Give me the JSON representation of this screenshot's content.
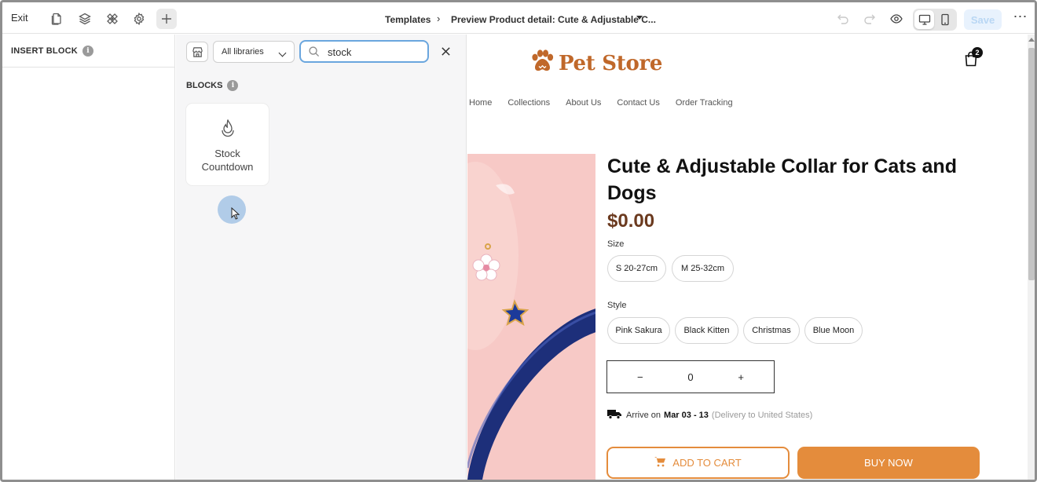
{
  "toolbar": {
    "exit_label": "Exit",
    "icons": [
      "pages-icon",
      "layers-icon",
      "theme-style-icon",
      "settings-icon",
      "add-icon"
    ],
    "breadcrumb_root": "Templates",
    "breadcrumb_current": "Preview Product detail: Cute & Adjustable C...",
    "save_label": "Save",
    "more_label": "⋯"
  },
  "left_panel": {
    "title": "INSERT BLOCK",
    "info_glyph": "i"
  },
  "library": {
    "library_select_value": "All libraries",
    "search_value": "stock",
    "blocks_heading": "BLOCKS",
    "blocks": [
      {
        "label": "Stock Countdown",
        "icon": "flame-icon"
      }
    ]
  },
  "preview": {
    "brand_name": "Pet Store",
    "cart_count": "2",
    "nav": [
      "Home",
      "Collections",
      "About Us",
      "Contact Us",
      "Order Tracking"
    ],
    "product_title": "Cute & Adjustable Collar for Cats and Dogs",
    "price": "$0.00",
    "size_label": "Size",
    "sizes": [
      "S 20-27cm",
      "M 25-32cm"
    ],
    "style_label": "Style",
    "styles": [
      "Pink Sakura",
      "Black Kitten",
      "Christmas",
      "Blue Moon"
    ],
    "quantity": {
      "minus": "−",
      "value": "0",
      "plus": "+"
    },
    "delivery": {
      "prefix": "Arrive on",
      "dates": "Mar 03 - 13",
      "suffix": "(Delivery to United States)"
    },
    "add_to_cart_label": "ADD TO CART",
    "buy_now_label": "BUY NOW"
  },
  "colors": {
    "accent": "#e48c3c",
    "brand": "#c0682a",
    "price": "#6b3a1f",
    "search_focus": "#6aa6de",
    "product_bg": "#f7c9c6",
    "save_disabled_bg": "#e8f2fd"
  }
}
